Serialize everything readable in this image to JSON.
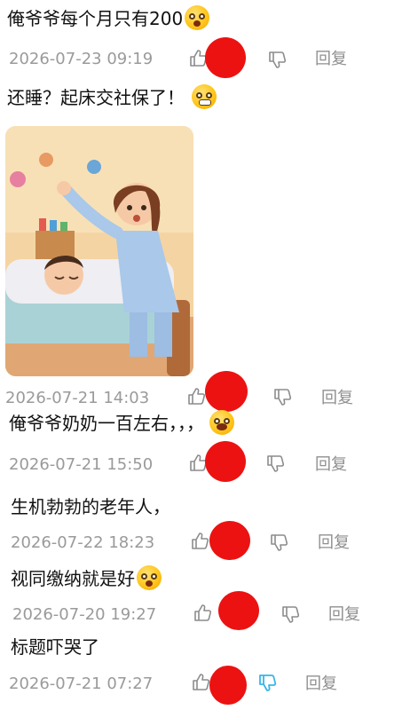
{
  "comments": [
    {
      "text": "俺爷爷每个月只有200",
      "time": "2026-07-23 09:19",
      "reply": "回复"
    },
    {
      "text": "还睡？起床交社保了！",
      "time": "2026-07-21 14:03",
      "reply": "回复"
    },
    {
      "text": "俺爷爷奶奶一百左右，，，",
      "time": "2026-07-21 15:50",
      "reply": "回复"
    },
    {
      "text": "生机勃勃的老年人，",
      "time": "2026-07-22 18:23",
      "reply": "回复"
    },
    {
      "text": "视同缴纳就是好",
      "time": "2026-07-20 19:27",
      "reply": "回复"
    },
    {
      "text": "标题吓哭了",
      "time": "2026-07-21 07:27",
      "reply": "回复"
    }
  ],
  "colors": {
    "redaction": "#ec1212",
    "dislike_active": "#38b6e8",
    "icon_gray": "#8c8c8c"
  }
}
